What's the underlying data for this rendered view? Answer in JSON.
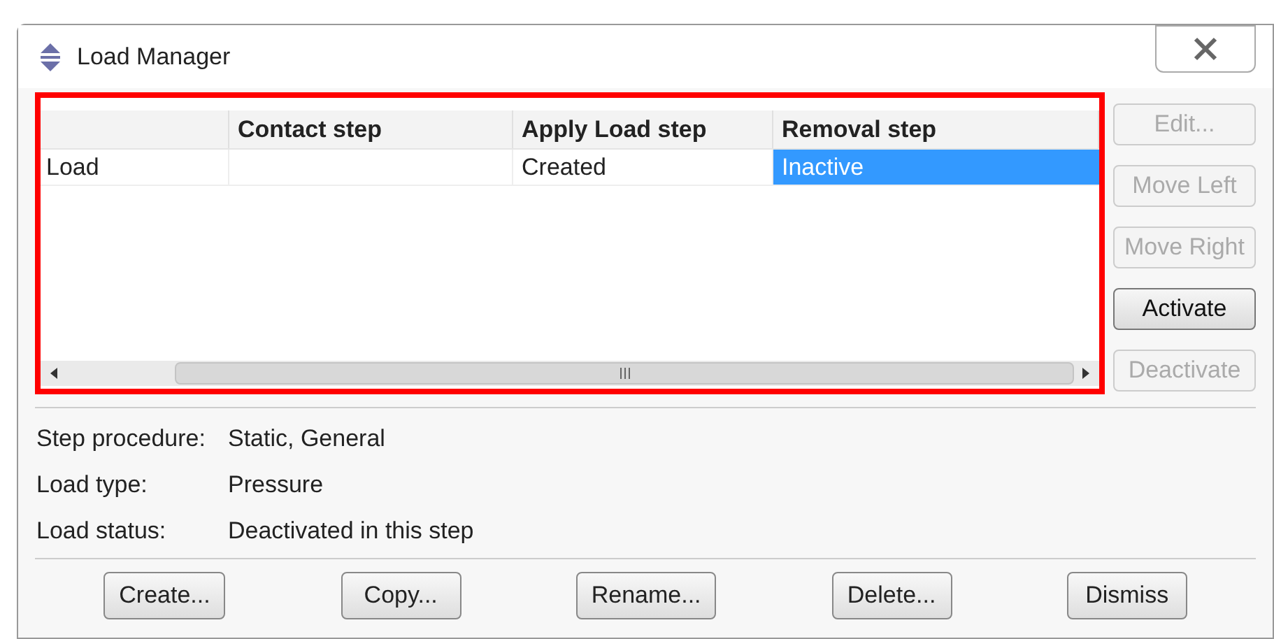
{
  "window": {
    "title": "Load Manager"
  },
  "table": {
    "columns": [
      "Contact step",
      "Apply Load step",
      "Removal step"
    ],
    "rows": [
      {
        "name": "Load",
        "cells": [
          {
            "selected": false
          },
          {
            "text": "Created",
            "selected": false
          },
          {
            "text": "Inactive",
            "selected": true
          }
        ]
      }
    ]
  },
  "side_buttons": [
    {
      "label": "Edit...",
      "disabled": true
    },
    {
      "label": "Move Left",
      "disabled": true
    },
    {
      "label": "Move Right",
      "disabled": true
    },
    {
      "label": "Activate",
      "disabled": false
    },
    {
      "label": "Deactivate",
      "disabled": true
    }
  ],
  "info": [
    {
      "label": "Step procedure:",
      "value": "Static, General"
    },
    {
      "label": "Load type:",
      "value": "Pressure"
    },
    {
      "label": "Load status:",
      "value": "Deactivated in this step"
    }
  ],
  "buttons": [
    "Create...",
    "Copy...",
    "Rename...",
    "Delete...",
    "Dismiss"
  ]
}
